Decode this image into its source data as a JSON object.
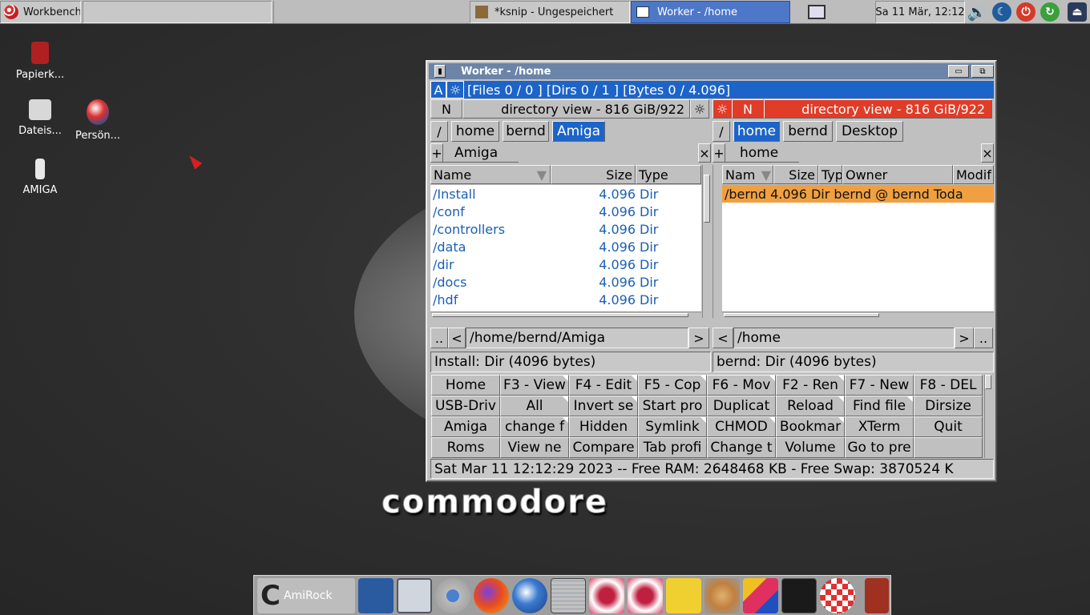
{
  "top_panel": {
    "menu_label": "Workbench",
    "tasks": [
      {
        "label": "*ksnip - Ungespeichert",
        "active": false
      },
      {
        "label": "Worker - /home",
        "active": true
      }
    ],
    "clock": "Sa 11 Mär, 12:12"
  },
  "desktop": {
    "icons": [
      {
        "label": "Papierk...",
        "icon": "trash-icon"
      },
      {
        "label": "Dateis...",
        "icon": "drive-icon"
      },
      {
        "label": "Persön...",
        "icon": "home-ball-icon"
      },
      {
        "label": "AMIGA",
        "icon": "usb-drive-icon"
      }
    ],
    "wallpaper_text": "commodore"
  },
  "worker": {
    "title": "Worker - /home",
    "stats_bar": {
      "a_label": "A",
      "text": "[Files  0 / 0     ]  [Dirs  0 / 1    ]  [Bytes           0 /        4.096]"
    },
    "left": {
      "mode_label": "N",
      "view_label": "directory view - 816 GiB/922",
      "path_buttons": [
        "/",
        "home",
        "bernd",
        "Amiga"
      ],
      "tab_plus": "+",
      "tab_label": "Amiga",
      "tab_close": "×",
      "columns": [
        "Name",
        "Size",
        "Type"
      ],
      "rows": [
        {
          "name": "/Install",
          "size": "4.096",
          "type": "Dir"
        },
        {
          "name": "/conf",
          "size": "4.096",
          "type": "Dir"
        },
        {
          "name": "/controllers",
          "size": "4.096",
          "type": "Dir"
        },
        {
          "name": "/data",
          "size": "4.096",
          "type": "Dir"
        },
        {
          "name": "/dir",
          "size": "4.096",
          "type": "Dir"
        },
        {
          "name": "/docs",
          "size": "4.096",
          "type": "Dir"
        },
        {
          "name": "/hdf",
          "size": "4.096",
          "type": "Dir"
        }
      ],
      "path_value": "/home/bernd/Amiga",
      "info": "Install: Dir (4096 bytes)"
    },
    "right": {
      "mode_label": "N",
      "view_label": "directory view - 816 GiB/922",
      "path_buttons": [
        "/",
        "home",
        "bernd",
        "Desktop"
      ],
      "tab_plus": "+",
      "tab_label": "home",
      "tab_close": "×",
      "columns": [
        "Nam",
        "Size",
        "Typ",
        "Owner",
        "Modif"
      ],
      "rows": [
        {
          "text": "/bernd 4.096 Dir bernd @ bernd Toda"
        }
      ],
      "path_value": "/home",
      "info": "bernd: Dir (4096 bytes)"
    },
    "nav": {
      "dotdot": "..",
      "back": "<",
      "fwd": ">"
    },
    "buttons": [
      [
        "Home",
        "F3 - View",
        "F4 - Edit",
        "F5 - Cop",
        "F6 - Mov",
        "F2 - Ren",
        "F7 - New",
        "F8 - DEL"
      ],
      [
        "USB-Driv",
        "All",
        "Invert se",
        "Start pro",
        "Duplicat",
        "Reload",
        "Find file",
        "Dirsize"
      ],
      [
        "Amiga",
        "change f",
        "Hidden",
        "Symlink",
        "CHMOD",
        "Bookmar",
        "XTerm",
        "Quit"
      ],
      [
        "Roms",
        "View ne",
        "Compare",
        "Tab profi",
        "Change t",
        "Volume",
        "Go to pre",
        ""
      ]
    ],
    "status": "Sat Mar 11 12:12:29 2023  --  Free RAM: 2648468 KB  -  Free Swap: 3870524 K"
  },
  "dock": {
    "first_label": "AmiRock",
    "items": [
      "amirock-icon",
      "scanner-icon",
      "window-icon",
      "chromium-icon",
      "firefox-icon",
      "thunderbird-icon",
      "worker-icon",
      "raspberry-icon",
      "raspberry-icon",
      "notes-icon",
      "paint-icon",
      "multicolor-icon",
      "amiga-icon",
      "boing-ball-icon",
      "trash-icon"
    ]
  },
  "colors": {
    "accent": "#1d64c8",
    "active_pane": "#e03c28",
    "selected_row": "#f0a040",
    "file_text": "#1a5fb4"
  }
}
